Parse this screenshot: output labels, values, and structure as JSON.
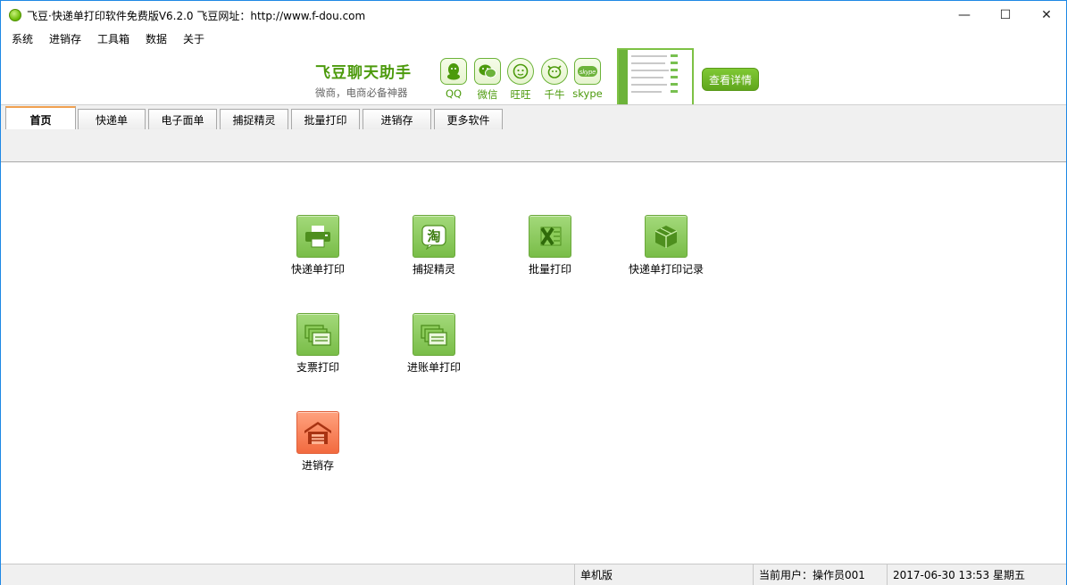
{
  "window": {
    "title": "飞豆·快递单打印软件免费版V6.2.0  飞豆网址：http://www.f-dou.com",
    "controls": {
      "minimize": "—",
      "maximize": "☐",
      "close": "✕"
    }
  },
  "menu": {
    "items": [
      {
        "label": "系统"
      },
      {
        "label": "进销存"
      },
      {
        "label": "工具箱"
      },
      {
        "label": "数据"
      },
      {
        "label": "关于"
      }
    ]
  },
  "banner": {
    "title": "飞豆聊天助手",
    "subtitle": "微商，电商必备神器",
    "apps": [
      {
        "name": "QQ",
        "icon": "qq-icon"
      },
      {
        "name": "微信",
        "icon": "wechat-icon"
      },
      {
        "name": "旺旺",
        "icon": "wangwang-icon"
      },
      {
        "name": "千牛",
        "icon": "qianniu-icon"
      },
      {
        "name": "skype",
        "icon": "skype-icon"
      }
    ],
    "detail_button": "查看详情",
    "accent": "#4c9a0c"
  },
  "tabs": [
    {
      "label": "首页",
      "active": true
    },
    {
      "label": "快递单"
    },
    {
      "label": "电子面单"
    },
    {
      "label": "捕捉精灵"
    },
    {
      "label": "批量打印"
    },
    {
      "label": "进销存"
    },
    {
      "label": "更多软件"
    }
  ],
  "tiles": [
    {
      "label": "快递单打印",
      "icon": "printer-icon"
    },
    {
      "label": "捕捉精灵",
      "icon": "taobao-icon"
    },
    {
      "label": "批量打印",
      "icon": "excel-icon"
    },
    {
      "label": "快递单打印记录",
      "icon": "package-icon"
    },
    {
      "label": "支票打印",
      "icon": "documents-icon"
    },
    {
      "label": "进账单打印",
      "icon": "documents-icon"
    },
    {
      "label": "进销存",
      "icon": "warehouse-icon",
      "color": "#f26a3f"
    }
  ],
  "status": {
    "mode": "单机版",
    "user": "当前用户：操作员001",
    "datetime": "2017-06-30 13:53 星期五"
  }
}
